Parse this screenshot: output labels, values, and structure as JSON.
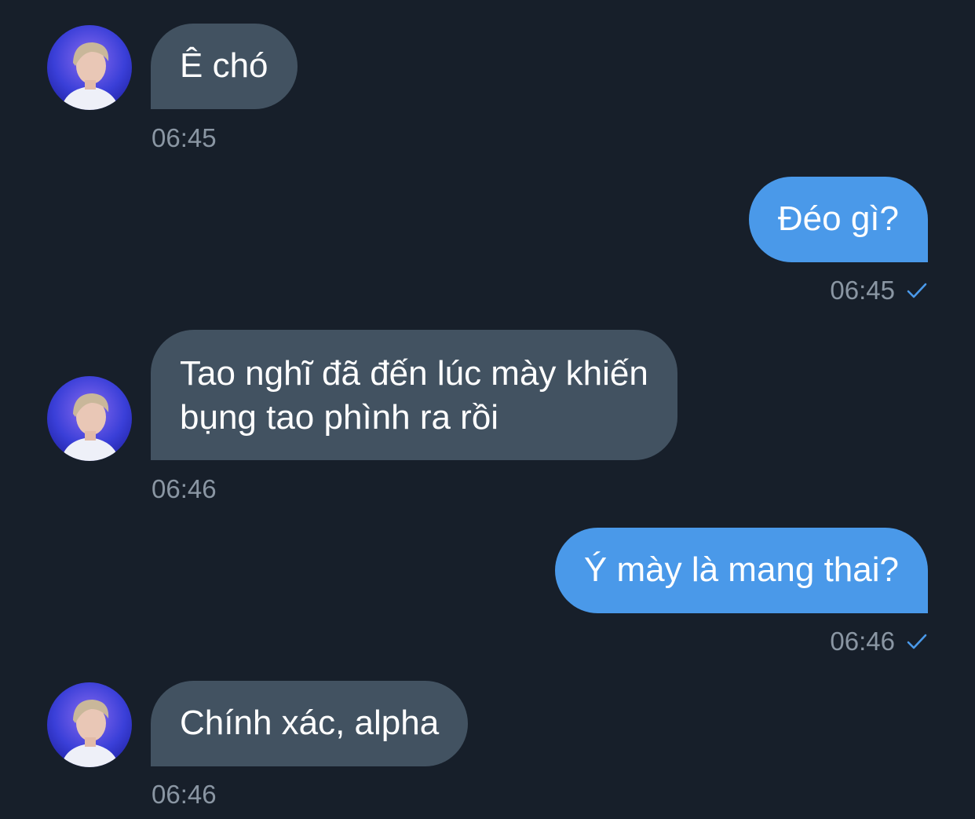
{
  "colors": {
    "background": "#171f2a",
    "incoming_bubble": "#425261",
    "outgoing_bubble": "#4a99e9",
    "timestamp": "#8a96a3",
    "read_check": "#4a99e9"
  },
  "messages": [
    {
      "direction": "incoming",
      "text": "Ê chó",
      "time": "06:45"
    },
    {
      "direction": "outgoing",
      "text": "Đéo gì?",
      "time": "06:45",
      "status_icon": "check-icon"
    },
    {
      "direction": "incoming",
      "text_line1": "Tao nghĩ đã đến lúc mày khiến",
      "text_line2": "bụng tao phình ra rồi",
      "time": "06:46"
    },
    {
      "direction": "outgoing",
      "text": "Ý mày là mang thai?",
      "time": "06:46",
      "status_icon": "check-icon"
    },
    {
      "direction": "incoming",
      "text": "Chính xác, alpha",
      "time": "06:46"
    }
  ]
}
